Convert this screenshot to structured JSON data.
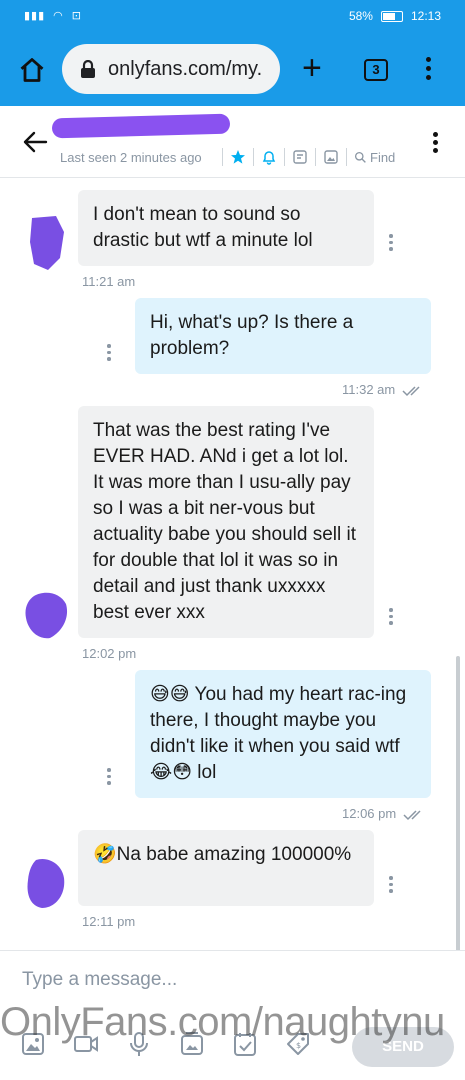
{
  "status_bar": {
    "battery": "58%",
    "battery_level": 0.58,
    "clock": "12:13"
  },
  "browser": {
    "url": "onlyfans.com/my.",
    "tab_count": "3"
  },
  "chat_header": {
    "last_seen": "Last seen 2 minutes ago",
    "find_label": "Find"
  },
  "messages": [
    {
      "direction": "in",
      "text": "I don't mean to sound so drastic but wtf a minute lol",
      "time": "11:21 am"
    },
    {
      "direction": "out",
      "text": "Hi, what's up? Is there a problem?",
      "time": "11:32 am"
    },
    {
      "direction": "in",
      "text": "That was the best rating I've EVER HAD. ANd i get a lot lol. It was more than I usu-ally pay so I was a bit ner-vous but actuality babe you should sell it for double that lol it was so in detail and just thank uxxxxx best ever xxx",
      "time": "12:02 pm"
    },
    {
      "direction": "out",
      "text": "😅😅 You had my heart rac-ing there, I thought maybe you didn't like it when you said wtf 😂😳 lol",
      "time": "12:06 pm"
    },
    {
      "direction": "in",
      "text": "🤣Na babe amazing 100000%",
      "time": "12:11 pm"
    }
  ],
  "composer": {
    "placeholder": "Type a message...",
    "send_label": "SEND"
  },
  "watermark": "OnlyFans.com/naughtynu",
  "colors": {
    "browser_bar": "#1a9be8",
    "incoming_bubble": "#f0f1f2",
    "outgoing_bubble": "#dff3fd",
    "accent": "#00aff0",
    "redaction": "#8a52f0"
  }
}
